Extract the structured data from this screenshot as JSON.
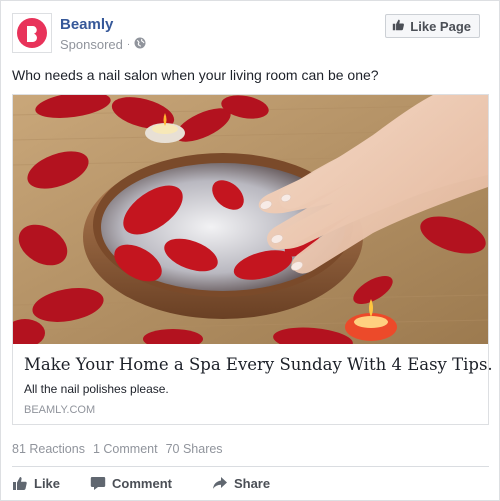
{
  "post": {
    "page_name": "Beamly",
    "sponsored_label": "Sponsored",
    "separator": "·",
    "like_page_label": "Like Page",
    "text": "Who needs a nail salon when your living room can be one?"
  },
  "link": {
    "title": "Make Your Home a Spa Every Sunday With 4 Easy Tips.",
    "description": "All the nail polishes please.",
    "domain": "BEAMLY.COM"
  },
  "stats": {
    "reactions": "81 Reactions",
    "comments": "1 Comment",
    "shares": "70 Shares"
  },
  "actions": {
    "like_label": "Like",
    "comment_label": "Comment",
    "share_label": "Share"
  },
  "icons": {
    "avatar": "beamly-logo-icon",
    "audience": "globe-icon",
    "like_page": "thumbs-up-icon",
    "like": "thumbs-up-icon",
    "comment": "comment-bubble-icon",
    "share": "share-arrow-icon"
  },
  "colors": {
    "brand": "#e8335a",
    "link_blue": "#365899",
    "muted": "#90949c"
  }
}
